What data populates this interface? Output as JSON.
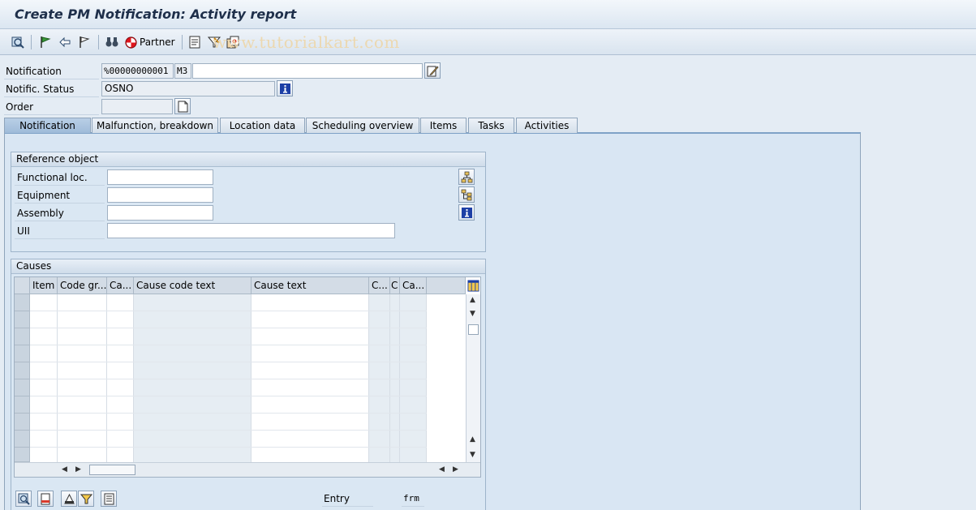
{
  "window": {
    "title": "Create PM Notification: Activity report"
  },
  "toolbar": {
    "partner_label": "Partner",
    "watermark": "www.tutorialkart.com"
  },
  "header": {
    "notification_label": "Notification",
    "notification_number": "%00000000001",
    "notification_type": "M3",
    "notification_description": "",
    "status_label": "Notific. Status",
    "status_value": "OSNO",
    "order_label": "Order",
    "order_value": ""
  },
  "tabs": [
    {
      "label": "Notification",
      "active": true
    },
    {
      "label": "Malfunction, breakdown",
      "active": false
    },
    {
      "label": "Location data",
      "active": false
    },
    {
      "label": "Scheduling overview",
      "active": false
    },
    {
      "label": "Items",
      "active": false
    },
    {
      "label": "Tasks",
      "active": false
    },
    {
      "label": "Activities",
      "active": false
    }
  ],
  "reference_object": {
    "title": "Reference object",
    "functional_loc_label": "Functional loc.",
    "functional_loc_value": "",
    "equipment_label": "Equipment",
    "equipment_value": "",
    "assembly_label": "Assembly",
    "assembly_value": "",
    "uii_label": "UII",
    "uii_value": ""
  },
  "causes": {
    "title": "Causes",
    "columns": [
      "Item",
      "Code gr...",
      "Ca...",
      "Cause code text",
      "Cause text",
      "C...",
      "C",
      "Ca..."
    ],
    "row_count": 10
  },
  "footer": {
    "entry_label": "Entry",
    "entry_value": "frm"
  },
  "colors": {
    "background": "#e4ecf4",
    "panel": "#d9e6f3",
    "active_tab": "#a8c2de",
    "title_text": "#1e2f4a"
  }
}
